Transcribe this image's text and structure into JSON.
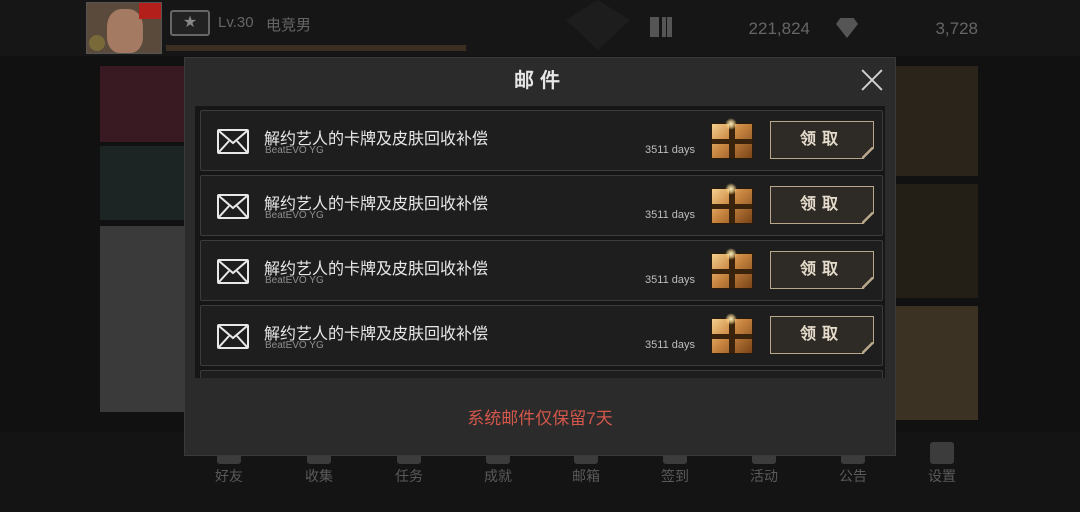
{
  "topbar": {
    "level": "Lv.30",
    "player_name": "电竞男",
    "coins": "221,824",
    "gems": "3,728",
    "rank_icon": "star-icon"
  },
  "modal": {
    "title": "邮件",
    "footer_note": "系统邮件仅保留7天",
    "close_icon": "close-icon",
    "mails": [
      {
        "title": "解约艺人的卡牌及皮肤回收补偿",
        "sender": "BeatEVO YG",
        "remaining": "3511 days",
        "claim_label": "领取"
      },
      {
        "title": "解约艺人的卡牌及皮肤回收补偿",
        "sender": "BeatEVO YG",
        "remaining": "3511 days",
        "claim_label": "领取"
      },
      {
        "title": "解约艺人的卡牌及皮肤回收补偿",
        "sender": "BeatEVO YG",
        "remaining": "3511 days",
        "claim_label": "领取"
      },
      {
        "title": "解约艺人的卡牌及皮肤回收补偿",
        "sender": "BeatEVO YG",
        "remaining": "3511 days",
        "claim_label": "领取"
      }
    ]
  },
  "bottom_nav": {
    "items": [
      {
        "label": "好友",
        "icon": "friends-icon"
      },
      {
        "label": "收集",
        "icon": "collection-icon"
      },
      {
        "label": "任务",
        "icon": "tasks-icon"
      },
      {
        "label": "成就",
        "icon": "achievement-icon"
      },
      {
        "label": "邮箱",
        "icon": "mailbox-icon"
      },
      {
        "label": "签到",
        "icon": "checkin-icon"
      },
      {
        "label": "活动",
        "icon": "event-icon"
      },
      {
        "label": "公告",
        "icon": "notice-icon"
      },
      {
        "label": "设置",
        "icon": "settings-icon"
      }
    ]
  },
  "colors": {
    "accent_note": "#d4574b",
    "button_border": "#b9a78c",
    "modal_bg": "#2b2b2b"
  }
}
